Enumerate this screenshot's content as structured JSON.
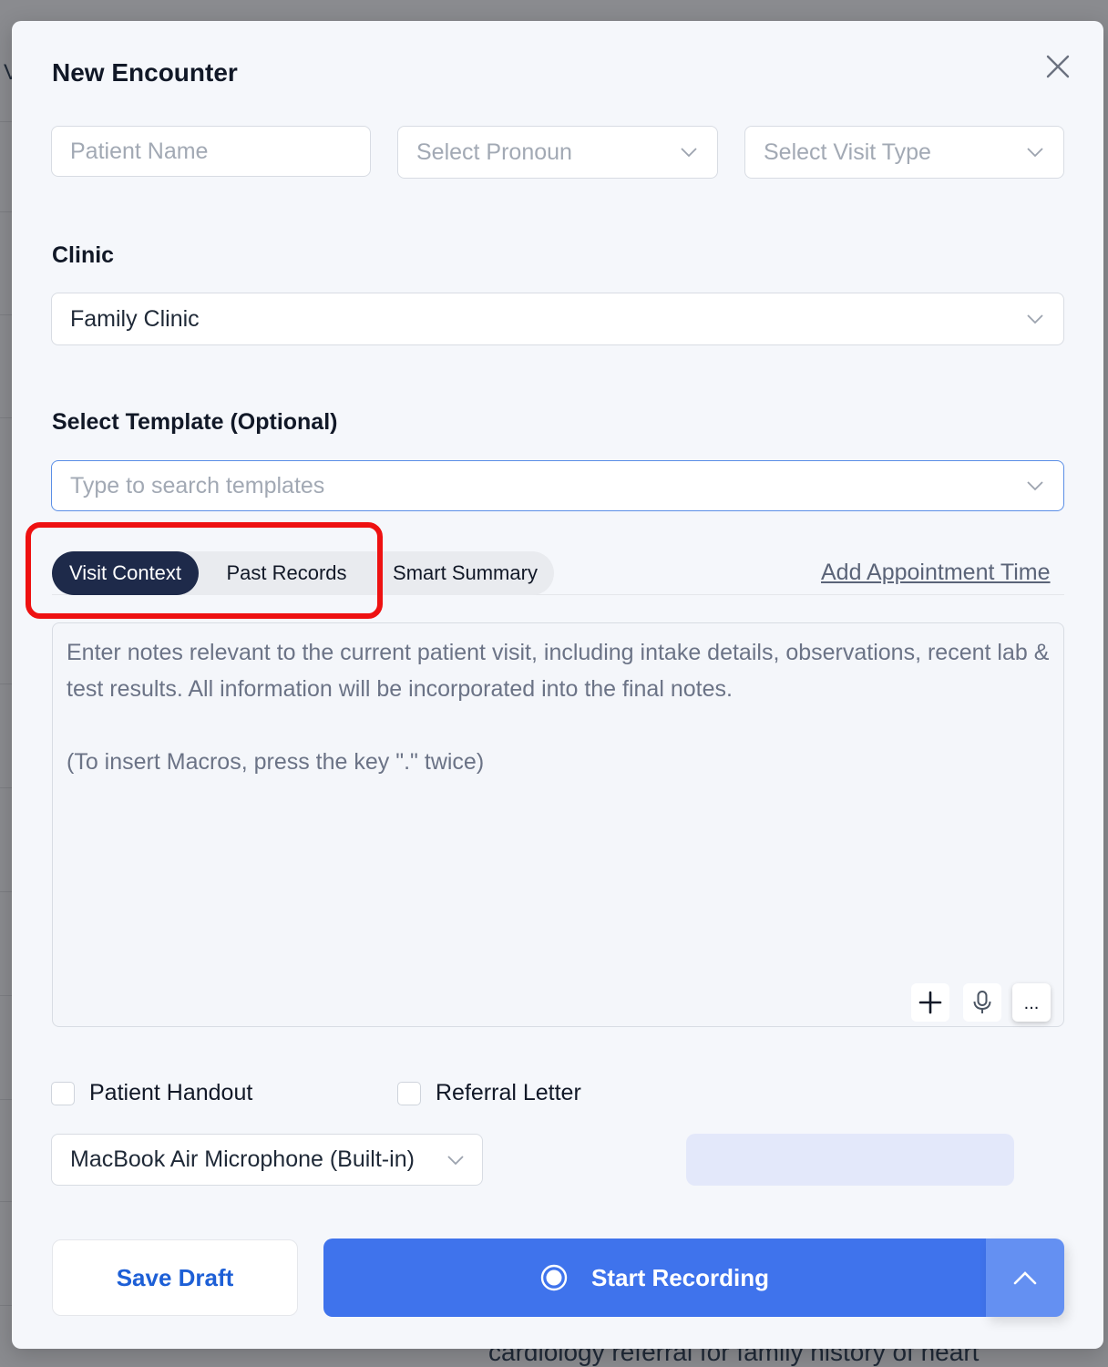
{
  "background": {
    "fragment_text": "V",
    "under_text": "cardiology referral for family history of heart"
  },
  "modal": {
    "title": "New Encounter",
    "close_icon": "close-icon"
  },
  "patient_name": {
    "placeholder": "Patient Name",
    "value": ""
  },
  "pronoun_select": {
    "placeholder": "Select Pronoun"
  },
  "visit_type_select": {
    "placeholder": "Select Visit Type"
  },
  "clinic": {
    "label": "Clinic",
    "selected": "Family Clinic"
  },
  "template": {
    "label": "Select Template (Optional)",
    "placeholder": "Type to search templates",
    "value": ""
  },
  "tabs": [
    {
      "label": "Visit Context",
      "active": true
    },
    {
      "label": "Past Records",
      "active": false
    },
    {
      "label": "Smart Summary",
      "active": false
    }
  ],
  "add_appointment_link": "Add Appointment Time",
  "notes": {
    "placeholder_line1": "Enter notes relevant to the current patient visit, including intake details, observations, recent lab & test results. All information will be incorporated into the final notes.",
    "placeholder_line2": "(To insert Macros, press the key \".\" twice)",
    "tools": [
      "plus-icon",
      "microphone-icon",
      "more-icon"
    ],
    "more_label": "..."
  },
  "checkboxes": [
    {
      "label": "Patient Handout",
      "checked": false
    },
    {
      "label": "Referral Letter",
      "checked": false
    }
  ],
  "microphone_select": {
    "selected": "MacBook Air Microphone (Built-in)"
  },
  "buttons": {
    "save_draft": "Save Draft",
    "start_recording": "Start Recording"
  },
  "colors": {
    "primary": "#3f73ec",
    "active_tab": "#1e2a4a",
    "link": "#1d5fd6",
    "highlight": "#ee1111"
  }
}
